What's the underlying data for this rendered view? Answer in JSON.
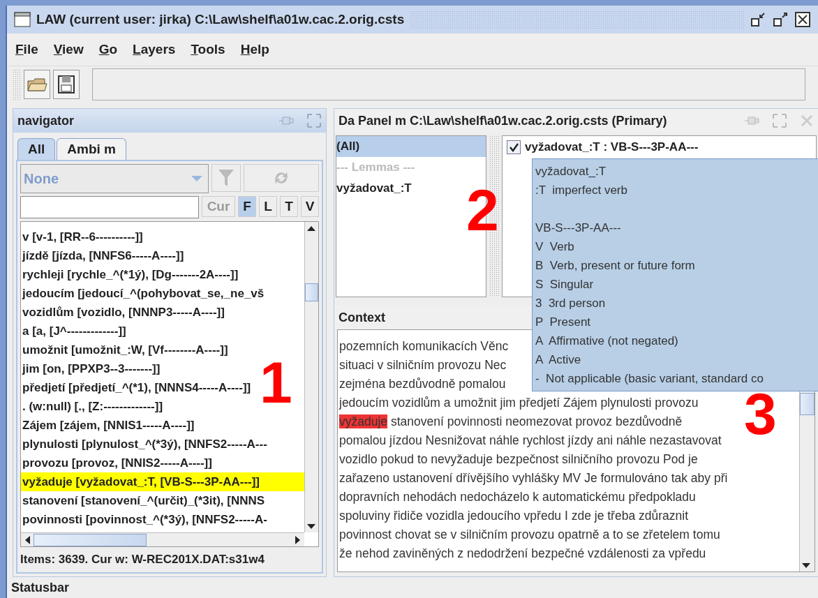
{
  "window": {
    "title": "LAW (current user: jirka) C:\\Law\\shelf\\a01w.cac.2.orig.csts"
  },
  "menu": [
    "File",
    "View",
    "Go",
    "Layers",
    "Tools",
    "Help"
  ],
  "navigator": {
    "title": "navigator",
    "tabs": [
      {
        "label": "All",
        "selected": true
      },
      {
        "label": "Ambi m",
        "selected": false
      }
    ],
    "combo": {
      "value": "None",
      "disabled": true
    },
    "cur_button": {
      "label": "Cur",
      "disabled": true
    },
    "toggles": [
      {
        "label": "F",
        "selected": true
      },
      {
        "label": "L",
        "selected": false
      },
      {
        "label": "T",
        "selected": false
      },
      {
        "label": "V",
        "selected": false
      }
    ],
    "items": [
      {
        "text": "v [v-1, [RR--6----------]]",
        "selected": false
      },
      {
        "text": "jízdě [jízda, [NNFS6-----A----]]",
        "selected": false
      },
      {
        "text": "rychleji [rychle_^(*1ý), [Dg-------2A----]]",
        "selected": false
      },
      {
        "text": "jedoucím [jedoucí_^(pohybovat_se,_ne_vš",
        "selected": false
      },
      {
        "text": "vozidlům [vozidlo, [NNNP3-----A----]]",
        "selected": false
      },
      {
        "text": "a [a, [J^-------------]]",
        "selected": false
      },
      {
        "text": "umožnit [umožnit_:W, [Vf--------A----]]",
        "selected": false
      },
      {
        "text": "jim [on, [PPXP3--3-------]]",
        "selected": false
      },
      {
        "text": "předjetí [předjetí_^(*1), [NNNS4-----A----]]",
        "selected": false
      },
      {
        "text": ". (w:null) [., [Z:-------------]]",
        "selected": false
      },
      {
        "text": "Zájem [zájem, [NNIS1-----A----]]",
        "selected": false
      },
      {
        "text": "plynulosti [plynulost_^(*3ý), [NNFS2-----A---",
        "selected": false
      },
      {
        "text": "provozu [provoz, [NNIS2-----A----]]",
        "selected": false
      },
      {
        "text": "vyžaduje [vyžadovat_:T, [VB-S---3P-AA---]]",
        "selected": true
      },
      {
        "text": "stanovení [stanovení_^(určit)_(*3it), [NNNS",
        "selected": false
      },
      {
        "text": "povinnosti [povinnost_^(*3ý), [NNFS2-----A-",
        "selected": false
      }
    ],
    "status": "Items: 3639. Cur w: W-REC201X.DAT:s31w4"
  },
  "panel": {
    "title": "Da Panel m C:\\Law\\shelf\\a01w.cac.2.orig.csts (Primary)",
    "filters": [
      {
        "kind": "item",
        "text": "(All)",
        "selected": true
      },
      {
        "kind": "separator",
        "text": "--- Lemmas ---",
        "selected": false
      },
      {
        "kind": "item",
        "text": "vyžadovat_:T",
        "selected": false
      }
    ],
    "results": [
      {
        "text": "vyžadovat_:T : VB-S---3P-AA---",
        "checked": true
      }
    ],
    "tooltip": [
      [
        "vyžadovat_:T",
        ":T  imperfect verb"
      ],
      [
        "VB-S---3P-AA---",
        "V  Verb",
        "B  Verb, present or future form",
        "S  Singular",
        "3  3rd person",
        "P  Present",
        "A  Affirmative (not negated)",
        "A  Active",
        "-  Not applicable (basic variant, standard co"
      ]
    ],
    "context_title": "Context",
    "context": [
      [
        {
          "text": "pozemních komunikacích Věnc",
          "highlighted": false
        }
      ],
      [
        {
          "text": "situaci v silničním provozu Nec",
          "highlighted": false
        }
      ],
      [
        {
          "text": "zejména bezdůvodně pomalou",
          "highlighted": false
        }
      ],
      [
        {
          "text": "jedoucím vozidlům a umožnit jim předjetí Zájem plynulosti provozu",
          "highlighted": false
        }
      ],
      [
        {
          "text": "vyžaduje",
          "highlighted": true
        },
        {
          "text": " stanovení povinnosti neomezovat provoz bezdůvodně",
          "highlighted": false
        }
      ],
      [
        {
          "text": "pomalou jízdou Nesnižovat náhle rychlost jízdy ani náhle nezastavovat",
          "highlighted": false
        }
      ],
      [
        {
          "text": "vozidlo pokud to nevyžaduje bezpečnost silničního provozu Pod je",
          "highlighted": false
        }
      ],
      [
        {
          "text": "zařazeno ustanovení dřívějšího vyhlášky MV Je formulováno tak aby při",
          "highlighted": false
        }
      ],
      [
        {
          "text": "dopravních nehodách nedocházelo k automatickému předpokladu",
          "highlighted": false
        }
      ],
      [
        {
          "text": "spoluviny řidiče vozidla jedoucího vpředu I zde je třeba zdůraznit",
          "highlighted": false
        }
      ],
      [
        {
          "text": "povinnost chovat se v silničním provozu opatrně a to se zřetelem tomu",
          "highlighted": false
        }
      ],
      [
        {
          "text": "že nehod zaviněných z nedodržení bezpečné vzdálenosti za vpředu",
          "highlighted": false
        }
      ]
    ]
  },
  "statusbar": "Statusbar",
  "callouts": [
    "1",
    "2",
    "3"
  ]
}
